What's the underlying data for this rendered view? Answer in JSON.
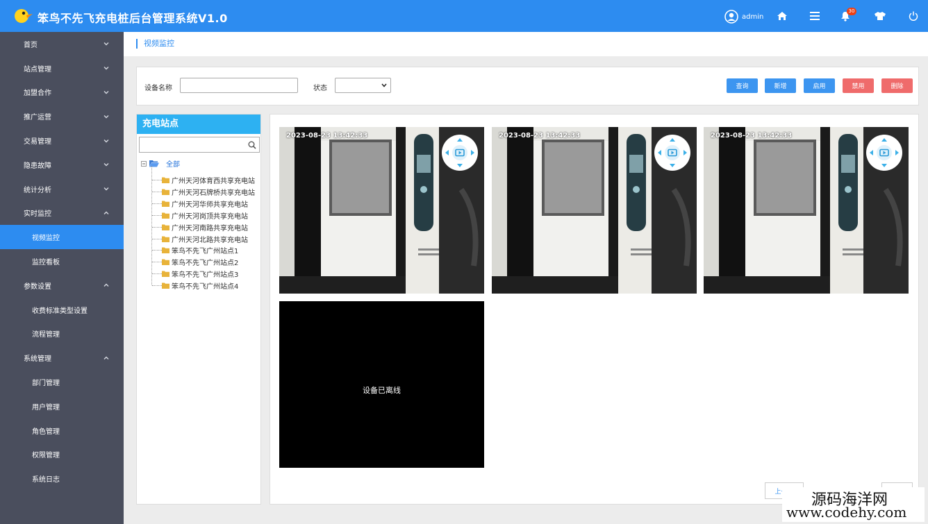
{
  "header": {
    "title": "笨鸟不先飞充电桩后台管理系统V1.0",
    "user_name": "admin",
    "notification_count": "30",
    "icons": [
      "user-avatar-icon",
      "home-icon",
      "menu-icon",
      "bell-icon",
      "shirt-icon",
      "power-icon"
    ]
  },
  "sidebar": {
    "items": [
      {
        "label": "首页",
        "type": "group",
        "expanded": false
      },
      {
        "label": "站点管理",
        "type": "group",
        "expanded": false
      },
      {
        "label": "加盟合作",
        "type": "group",
        "expanded": false
      },
      {
        "label": "推广运营",
        "type": "group",
        "expanded": false
      },
      {
        "label": "交易管理",
        "type": "group",
        "expanded": false
      },
      {
        "label": "隐患故障",
        "type": "group",
        "expanded": false
      },
      {
        "label": "统计分析",
        "type": "group",
        "expanded": false
      },
      {
        "label": "实时监控",
        "type": "group",
        "expanded": true
      },
      {
        "label": "视频监控",
        "type": "sub",
        "active": true
      },
      {
        "label": "监控看板",
        "type": "sub"
      },
      {
        "label": "参数设置",
        "type": "group",
        "expanded": true
      },
      {
        "label": "收费标准类型设置",
        "type": "sub"
      },
      {
        "label": "流程管理",
        "type": "sub"
      },
      {
        "label": "系统管理",
        "type": "group",
        "expanded": true
      },
      {
        "label": "部门管理",
        "type": "sub"
      },
      {
        "label": "用户管理",
        "type": "sub"
      },
      {
        "label": "角色管理",
        "type": "sub"
      },
      {
        "label": "权限管理",
        "type": "sub"
      },
      {
        "label": "系统日志",
        "type": "sub"
      }
    ]
  },
  "breadcrumb": {
    "current": "视频监控"
  },
  "filter": {
    "device_name_label": "设备名称",
    "device_name_value": "",
    "status_label": "状态",
    "status_value": "",
    "buttons": {
      "query": "查询",
      "add": "新增",
      "enable": "启用",
      "disable": "禁用",
      "delete": "删除"
    },
    "colors": {
      "primary": "#3c95f0",
      "danger": "#ef6b6b"
    }
  },
  "tree": {
    "title": "充电站点",
    "search_value": "",
    "root_label": "全部",
    "children": [
      "广州天河体育西共享充电站",
      "广州天河石牌桥共享充电站",
      "广州天河华师共享充电站",
      "广州天河岗顶共享充电站",
      "广州天河南路共享充电站",
      "广州天河北路共享充电站",
      "笨鸟不先飞广州站点1",
      "笨鸟不先飞广州站点2",
      "笨鸟不先飞广州站点3",
      "笨鸟不先飞广州站点4"
    ]
  },
  "videos": [
    {
      "timestamp": "2023-08-23 13:42:33",
      "online": true
    },
    {
      "timestamp": "2023-08-23 13:42:33",
      "online": true
    },
    {
      "timestamp": "2023-08-23 13:42:33",
      "online": true
    },
    {
      "status_text": "设备已离线",
      "online": false
    }
  ],
  "pager": {
    "prev": "上一页",
    "next": "下一页"
  },
  "watermark": {
    "cn": "源码海洋网",
    "url": "www.codehy.com"
  }
}
